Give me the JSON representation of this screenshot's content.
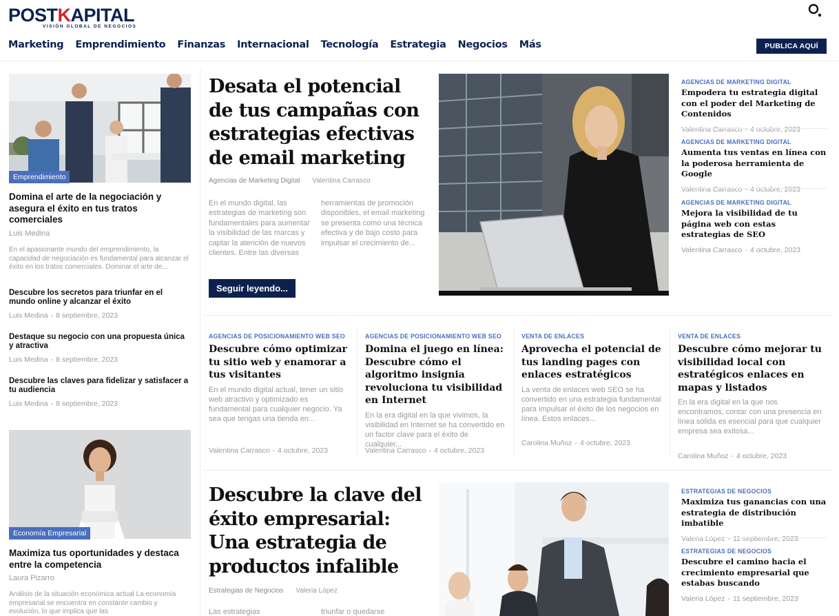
{
  "header": {
    "logo_post": "POST",
    "logo_k": "K",
    "logo_apital": "APITAL",
    "logo_tagline": "VISIÓN GLOBAL DE NEGOCIOS",
    "publica_label": "PUBLICA AQUÍ"
  },
  "nav": [
    "Marketing",
    "Emprendimiento",
    "Finanzas",
    "Internacional",
    "Tecnología",
    "Estrategia",
    "Negocios",
    "Más"
  ],
  "left_top": {
    "badge": "Emprendimiento",
    "title": "Domina el arte de la negociación y asegura el éxito en tus tratos comerciales",
    "author": "Luis Medina",
    "excerpt": "En el apasionante mundo del emprendimiento, la capacidad de negociación es fundamental para alcanzar el éxito en los tratos comerciales. Dominar el arte de...",
    "items": [
      {
        "title": "Descubre los secretos para triunfar en el mundo online y alcanzar el éxito",
        "author": "Luis Medina",
        "date": "8 septiembre, 2023"
      },
      {
        "title": "Destaque su negocio con una propuesta única y atractiva",
        "author": "Luis Medina",
        "date": "8 septiembre, 2023"
      },
      {
        "title": "Descubre las claves para fidelizar y satisfacer a tu audiencia",
        "author": "Luis Medina",
        "date": "8 septiembre, 2023"
      }
    ]
  },
  "left_bottom": {
    "badge": "Economía Empresarial",
    "title": "Maximiza tus oportunidades y destaca entre la competencia",
    "author": "Laura Pizarro",
    "excerpt": "Análisis de la situación económica actual La economía empresarial se encuentra en constante cambio y evolución, lo que implica que las"
  },
  "hero1": {
    "title": "Desata el potencial de tus campañas con estrategias efectivas de email marketing",
    "category": "Agencias de Marketing Digital",
    "author": "Valentina Carrasco",
    "col1": "En el mundo digital, las estrategias de marketing son fundamentales para aumentar la visibilidad de las marcas y captar la atención de nuevos clientes. Entre las diversas",
    "col2": "herramientas de promoción disponibles, el email marketing se presenta como una técnica efectiva y de bajo costo para impulsar el crecimiento de...",
    "button": "Seguir leyendo..."
  },
  "right_list1": [
    {
      "cat": "AGENCIAS DE MARKETING DIGITAL",
      "title": "Empodera tu estrategia digital con el poder del Marketing de Contenidos",
      "author": "Valentina Carrasco",
      "date": "4 octubre, 2023"
    },
    {
      "cat": "AGENCIAS DE MARKETING DIGITAL",
      "title": "Aumenta tus ventas en línea con la poderosa herramienta de Google",
      "author": "Valentina Carrasco",
      "date": "4 octubre, 2023"
    },
    {
      "cat": "AGENCIAS DE MARKETING DIGITAL",
      "title": "Mejora la visibilidad de tu página web con estas estrategias de SEO",
      "author": "Valentina Carrasco",
      "date": "4 octubre, 2023"
    }
  ],
  "mid_grid": [
    {
      "cat": "AGENCIAS DE POSICIONAMIENTO WEB SEO",
      "title": "Descubre cómo optimizar tu sitio web y enamorar a tus visitantes",
      "excerpt": "En el mundo digital actual, tener un sitio web atractivo y optimizado es fundamental para cualquier negocio. Ya sea que tengas una tienda en...",
      "author": "Valentina Carrasco",
      "date": "4 octubre, 2023"
    },
    {
      "cat": "AGENCIAS DE POSICIONAMIENTO WEB SEO",
      "title": "Domina el juego en línea: Descubre cómo el algoritmo insignia revoluciona tu visibilidad en Internet",
      "excerpt": "En la era digital en la que vivimos, la visibilidad en Internet se ha convertido en un factor clave para el éxito de cualquier...",
      "author": "Valentina Carrasco",
      "date": "4 octubre, 2023"
    },
    {
      "cat": "VENTA DE ENLACES",
      "title": "Aprovecha el potencial de tus landing pages con enlaces estratégicos",
      "excerpt": "La venta de enlaces web SEO se ha convertido en una estrategia fundamental para impulsar el éxito de los negocios en línea. Estos enlaces...",
      "author": "Carolina Muñoz",
      "date": "4 octubre, 2023"
    },
    {
      "cat": "VENTA DE ENLACES",
      "title": "Descubre cómo mejorar tu visibilidad local con estratégicos enlaces en mapas y listados",
      "excerpt": "En la era digital en la que nos encontramos, contar con una presencia en línea sólida es esencial para que cualquier empresa sea exitosa...",
      "author": "Carolina Muñoz",
      "date": "4 octubre, 2023"
    }
  ],
  "hero2": {
    "title": "Descubre la clave del éxito empresarial: Una estrategia de productos infalible",
    "category": "Estrategias de Negocios",
    "author": "Valeria López",
    "col1": "Las estrategias",
    "col2": "triunfar o quedarse"
  },
  "right_list2": [
    {
      "cat": "ESTRATEGIAS DE NEGOCIOS",
      "title": "Maximiza tus ganancias con una estrategia de distribución imbatible",
      "author": "Valeria López",
      "date": "11 septiembre, 2023"
    },
    {
      "cat": "ESTRATEGIAS DE NEGOCIOS",
      "title": "Descubre el camino hacia el crecimiento empresarial que estabas buscando",
      "author": "Valeria López",
      "date": "11 septiembre, 2023"
    }
  ],
  "colors": {
    "navy": "#0d2150",
    "accent_blue": "#4a6fbd",
    "logo_red": "#d2232a"
  }
}
